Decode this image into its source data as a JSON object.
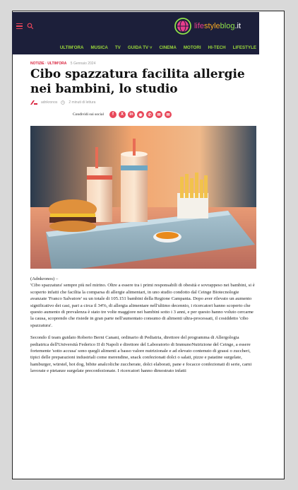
{
  "header": {
    "logo_parts": [
      "life",
      "style",
      "blog",
      ".it"
    ]
  },
  "categories": [
    "ULTIM'ORA",
    "MUSICA",
    "TV",
    "GUIDA TV ˅",
    "CINEMA",
    "MOTORI",
    "HI-TECH",
    "LIFESTYLE"
  ],
  "article": {
    "breadcrumb": [
      "NOTIZIE",
      "ULTIM'ORA"
    ],
    "breadcrumb_sep": " · ",
    "date": "5 Gennaio 2024",
    "title": "Cibo spazzatura facilita allergie nei bambini, lo studio",
    "author": "adnkronos",
    "read_time": "2 minuti di lettura",
    "share_label": "Condividi sui social",
    "social": [
      "f",
      "X",
      "in",
      "◉",
      "✆",
      "✉",
      "✉"
    ],
    "source": "(Adnkronos) –",
    "paragraph1": "'Cibo spazzatura' sempre più nel mirino. Oltre a essere tra i primi responsabili di obesità e sovrappeso nei bambini, si è scoperto infatti che facilita la comparsa di allergie alimentari, in uno studio condotto dal Ceinge Biotecnologie avanzate 'Franco Salvatore' su un totale di 105.151 bambini della Regione Campania. Dopo aver rilevato un aumento significativo dei casi, pari a circa il 34%, di allergia alimentare nell'ultimo decennio, i ricercatori hanno scoperto che questo aumento di prevalenza è stato tre volte maggiore nei bambini sotto i 3 anni, e per questo hanno voluto cercarne la causa, scoprendo che risiede in gran parte nell'aumentato consumo di alimenti ultra-processati, il cosiddetto 'cibo spazzatura'.",
    "paragraph2": "Secondo il team guidato Roberto Berni Canani, ordinario di Pediatria, direttore del programma di Allergologia pediatrica dell'Università Federico II di Napoli e direttore del Laboratorio di ImmunoNutrizione del Ceinge, a essere fortemente 'sotto accusa' sono quegli alimenti a basso valore nutrizionale e ad elevato contenuto di grassi o zuccheri, tipici delle preparazioni industriali come merendine, snack confezionati dolci o salati, pizze e patatine surgelate, hamburger, würstel, hot dog, bibite analcoliche zuccherate, dolci elaborati, pane e focacce confezionati di serie, carni lavorate e pietanze surgelate preconfezionate. I ricercatori hanno dimostrato infatti"
  },
  "colors": {
    "nav_bg": "#1c1f3a",
    "category_green": "#9bd83a",
    "accent_red": "#d9233d",
    "social_bg": "#e8485a"
  },
  "icons": {
    "menu": "hamburger-icon",
    "search": "search-icon",
    "clock": "clock-icon",
    "author": "adnkronos-logo"
  }
}
